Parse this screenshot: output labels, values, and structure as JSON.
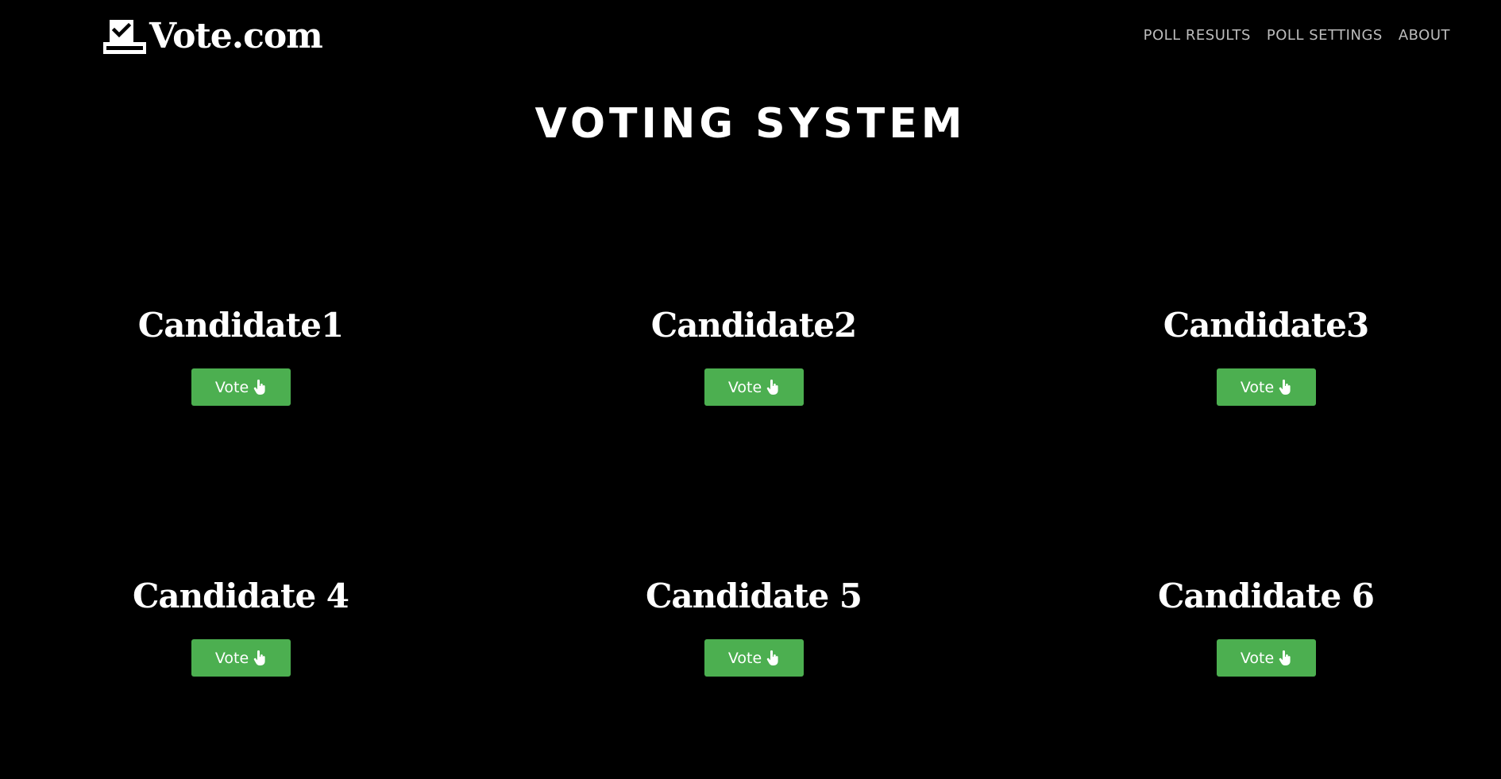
{
  "header": {
    "logo_text": "Vote.com",
    "logo_icon": "ballot-box-check-icon",
    "nav": [
      {
        "label": "POLL RESULTS"
      },
      {
        "label": "POLL SETTINGS"
      },
      {
        "label": "ABOUT"
      }
    ]
  },
  "main": {
    "title": "VOTING SYSTEM",
    "candidates": [
      {
        "name": "Candidate1",
        "button_label": "Vote",
        "button_icon": "hand-pointer-icon"
      },
      {
        "name": "Candidate2",
        "button_label": "Vote",
        "button_icon": "hand-pointer-icon"
      },
      {
        "name": "Candidate3",
        "button_label": "Vote",
        "button_icon": "hand-pointer-icon"
      },
      {
        "name": "Candidate 4",
        "button_label": "Vote",
        "button_icon": "hand-pointer-icon"
      },
      {
        "name": "Candidate 5",
        "button_label": "Vote",
        "button_icon": "hand-pointer-icon"
      },
      {
        "name": "Candidate 6",
        "button_label": "Vote",
        "button_icon": "hand-pointer-icon"
      }
    ]
  },
  "colors": {
    "background": "#000000",
    "accent": "#4caf50",
    "nav_text": "#bdbdbd",
    "text": "#ffffff"
  }
}
